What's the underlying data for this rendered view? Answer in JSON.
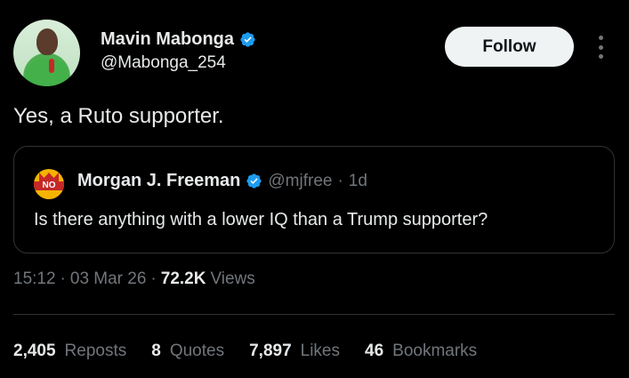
{
  "author": {
    "name": "Mavin Mabonga",
    "handle": "@Mabonga_254",
    "verified": true
  },
  "follow_label": "Follow",
  "tweet_text": "Yes, a Ruto supporter.",
  "quoted": {
    "name": "Morgan J. Freeman",
    "handle": "@mjfree",
    "separator": "·",
    "time": "1d",
    "text": "Is there anything with a lower IQ than a Trump supporter?",
    "avatar_text": "NO"
  },
  "meta": {
    "time": "15:12",
    "sep1": "·",
    "date": "03 Mar 26",
    "sep2": "·",
    "views_num": "72.2K",
    "views_label": "Views"
  },
  "stats": [
    {
      "num": "2,405",
      "label": "Reposts"
    },
    {
      "num": "8",
      "label": "Quotes"
    },
    {
      "num": "7,897",
      "label": "Likes"
    },
    {
      "num": "46",
      "label": "Bookmarks"
    }
  ],
  "colors": {
    "background": "#000000",
    "text": "#e7e9ea",
    "muted": "#71767b",
    "verified_blue": "#1d9bf0",
    "border": "#2f3336"
  },
  "icons": {
    "verified": "verified-badge-icon",
    "more": "more-options-icon"
  }
}
